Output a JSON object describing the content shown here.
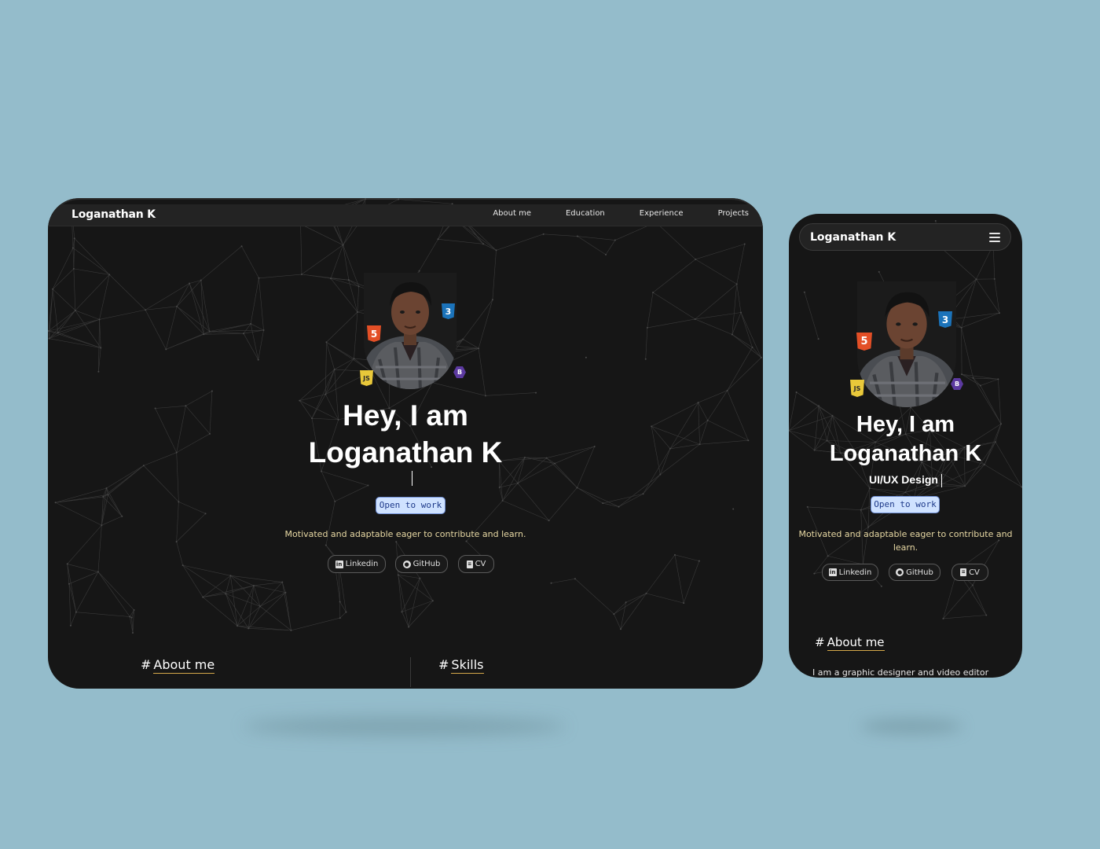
{
  "desktop": {
    "brand": "Loganathan K",
    "nav": [
      "About me",
      "Education",
      "Experience",
      "Projects"
    ],
    "title_line1": "Hey, I am",
    "title_line2": "Loganathan K",
    "badge_text": "Open to work",
    "tagline": "Motivated and adaptable eager to contribute and learn.",
    "links": [
      {
        "label": "Linkedin",
        "icon": "linkedin-icon"
      },
      {
        "label": "GitHub",
        "icon": "github-icon"
      },
      {
        "label": "CV",
        "icon": "document-icon"
      }
    ],
    "sections": [
      "About me",
      "Skills"
    ],
    "tech_badges": {
      "html": "5",
      "css": "3",
      "js": "JS",
      "bootstrap": "B"
    }
  },
  "mobile": {
    "brand": "Loganathan K",
    "menu_icon": "hamburger-menu-icon",
    "title_line1": "Hey, I am",
    "title_line2": "Loganathan K",
    "role": "UI/UX Design",
    "badge_text": "Open to work",
    "tagline": "Motivated and adaptable eager to contribute and learn.",
    "links": [
      {
        "label": "Linkedin",
        "icon": "linkedin-icon"
      },
      {
        "label": "GitHub",
        "icon": "github-icon"
      },
      {
        "label": "CV",
        "icon": "document-icon"
      }
    ],
    "section": "About me",
    "about_text": "I am a graphic designer and video editor"
  },
  "colors": {
    "background": "#94bccb",
    "surface": "#161616",
    "accent_badge": "#cfe2ff",
    "tagline": "#e8d9a4",
    "underline": "#d4a84a"
  }
}
